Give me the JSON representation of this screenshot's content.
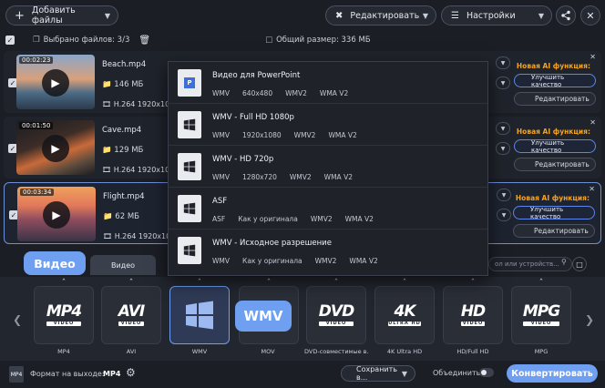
{
  "toolbar": {
    "add_files_label": "Добавить файлы",
    "edit_label": "Редактировать",
    "settings_label": "Настройки"
  },
  "subbar": {
    "selected_label": "Выбрано файлов: 3/3",
    "total_size_label": "Общий размер: 336 МБ"
  },
  "files": [
    {
      "duration": "00:02:23",
      "name": "Beach.mp4",
      "size": "146 МБ",
      "codec": "H.264 1920x108"
    },
    {
      "duration": "00:01:50",
      "name": "Cave.mp4",
      "size": "129 МБ",
      "codec": "H.264 1920x108"
    },
    {
      "duration": "00:03:34",
      "name": "Flight.mp4",
      "size": "62 МБ",
      "codec": "H.264 1920x108"
    }
  ],
  "file_actions": {
    "ai_label": "Новая AI функция:",
    "ai_button": "Улучшить качество",
    "edit_button": "Редактировать"
  },
  "presets": [
    {
      "title": "Видео для PowerPoint",
      "specs": [
        "WMV",
        "640x480",
        "WMV2",
        "WMA V2"
      ]
    },
    {
      "title": "WMV - Full HD 1080p",
      "specs": [
        "WMV",
        "1920x1080",
        "WMV2",
        "WMA V2"
      ]
    },
    {
      "title": "WMV - HD 720p",
      "specs": [
        "WMV",
        "1280x720",
        "WMV2",
        "WMA V2"
      ]
    },
    {
      "title": "ASF",
      "specs": [
        "ASF",
        "Как у оригинала",
        "WMV2",
        "WMA V2"
      ]
    },
    {
      "title": "WMV - Исходное разрешение",
      "specs": [
        "WMV",
        "Как у оригинала",
        "WMV2",
        "WMA V2"
      ]
    }
  ],
  "tabs": {
    "video_tag": "Видео",
    "video_tab": "Видео",
    "search_placeholder": "ол или устройств..."
  },
  "formats": [
    {
      "logo": "MP4",
      "sub": "VIDEO",
      "label": "MP4"
    },
    {
      "logo": "AVI",
      "sub": "VIDEO",
      "label": "AVI"
    },
    {
      "logo": "",
      "sub": "",
      "label": "WMV"
    },
    {
      "logo": "",
      "sub": "",
      "label": "MOV"
    },
    {
      "logo": "DVD",
      "sub": "VIDEO",
      "label": "DVD-совместимые в..."
    },
    {
      "logo": "4K",
      "sub": "ULTRA HD",
      "label": "4K Ultra HD"
    },
    {
      "logo": "HD",
      "sub": "VIDEO",
      "label": "HD/Full HD"
    },
    {
      "logo": "MPG",
      "sub": "VIDEO",
      "label": "MPG"
    }
  ],
  "wmv_tag": "WMV",
  "bottom": {
    "output_label": "Формат на выходе:",
    "output_value": "MP4",
    "save_label": "Сохранить в...",
    "merge_label": "Объединить:",
    "convert_label": "Конвертировать"
  },
  "colors": {
    "accent": "#6e9ff0",
    "ai_orange": "#f6a31c",
    "background": "#1b1e25"
  }
}
